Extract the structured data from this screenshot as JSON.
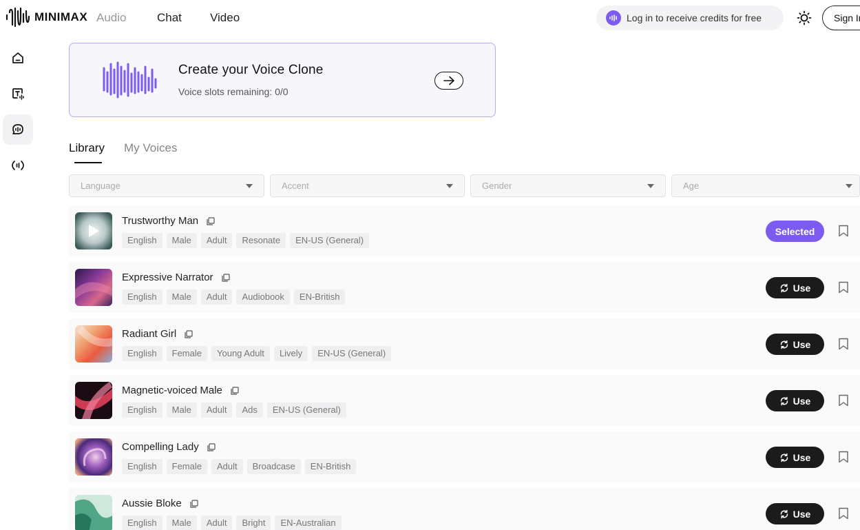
{
  "brand": {
    "name": "MINIMAX",
    "accent": "#7c5cf0"
  },
  "nav": {
    "audio": "Audio",
    "chat": "Chat",
    "video": "Video"
  },
  "header": {
    "credits_text": "Log in to receive credits for free",
    "signin": "Sign In"
  },
  "clone": {
    "title": "Create your Voice Clone",
    "subtitle": "Voice slots remaining: 0/0"
  },
  "tabs": {
    "library": "Library",
    "my_voices": "My Voices"
  },
  "filters": {
    "language": "Language",
    "accent": "Accent",
    "gender": "Gender",
    "age": "Age"
  },
  "voices": [
    {
      "name": "Trustworthy Man",
      "tags": [
        "English",
        "Male",
        "Adult",
        "Resonate",
        "EN-US (General)"
      ],
      "action": "Selected"
    },
    {
      "name": "Expressive Narrator",
      "tags": [
        "English",
        "Male",
        "Adult",
        "Audiobook",
        "EN-British"
      ],
      "action": "Use"
    },
    {
      "name": "Radiant Girl",
      "tags": [
        "English",
        "Female",
        "Young Adult",
        "Lively",
        "EN-US (General)"
      ],
      "action": "Use"
    },
    {
      "name": "Magnetic-voiced Male",
      "tags": [
        "English",
        "Male",
        "Adult",
        "Ads",
        "EN-US (General)"
      ],
      "action": "Use"
    },
    {
      "name": "Compelling Lady",
      "tags": [
        "English",
        "Female",
        "Adult",
        "Broadcase",
        "EN-British"
      ],
      "action": "Use"
    },
    {
      "name": "Aussie Bloke",
      "tags": [
        "English",
        "Male",
        "Adult",
        "Bright",
        "EN-Australian"
      ],
      "action": "Use"
    }
  ],
  "icons": {
    "logo": "waveform-logo-icon",
    "sidebar": [
      "home-icon",
      "text-to-speech-icon",
      "voice-chat-icon",
      "audio-broadcast-icon"
    ],
    "theme": "sun-icon",
    "row_copy": "copy-icon",
    "row_bookmark": "bookmark-icon",
    "use": "refresh-icon",
    "clone_arrow": "arrow-right-icon"
  }
}
